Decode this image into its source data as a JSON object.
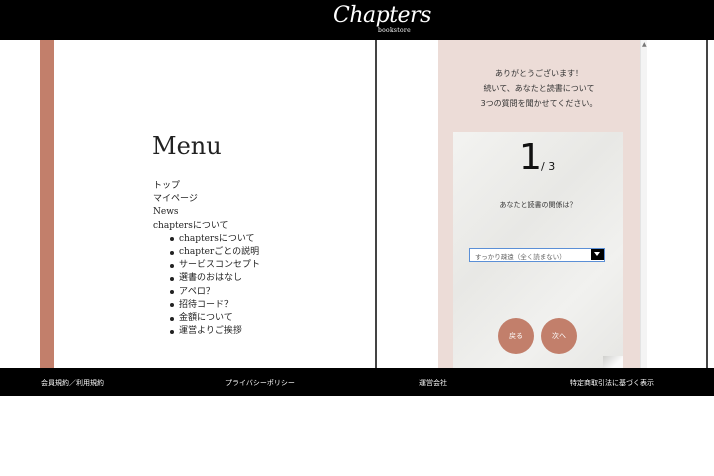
{
  "header": {
    "logo_text": "Chapters",
    "logo_sub": "bookstore"
  },
  "menu": {
    "title": "Menu",
    "items": [
      "トップ",
      "マイページ",
      "News",
      "chaptersについて"
    ],
    "sub_items": [
      "chaptersについて",
      "chapterごとの説明",
      "サービスコンセプト",
      "選書のおはなし",
      "アペロ？",
      "招待コード？",
      "金額について",
      "運営よりご挨拶"
    ]
  },
  "survey": {
    "intro_lines": [
      "ありがとうございます！",
      "続いて、あなたと読書について",
      "3つの質問を聞かせてください。"
    ],
    "question_number": "1",
    "question_total": "/ 3",
    "question_text": "あなたと読書の関係は？",
    "select_value": "すっかり疎遠（全く読まない）",
    "back_label": "戻る",
    "next_label": "次へ"
  },
  "footer": {
    "links": [
      "会員規約／利用規約",
      "プライバシーポリシー",
      "運営会社",
      "特定商取引法に基づく表示"
    ]
  },
  "colors": {
    "accent": "#c27f6b",
    "survey_background": "#ecdcd7",
    "header_footer": "#000000"
  }
}
